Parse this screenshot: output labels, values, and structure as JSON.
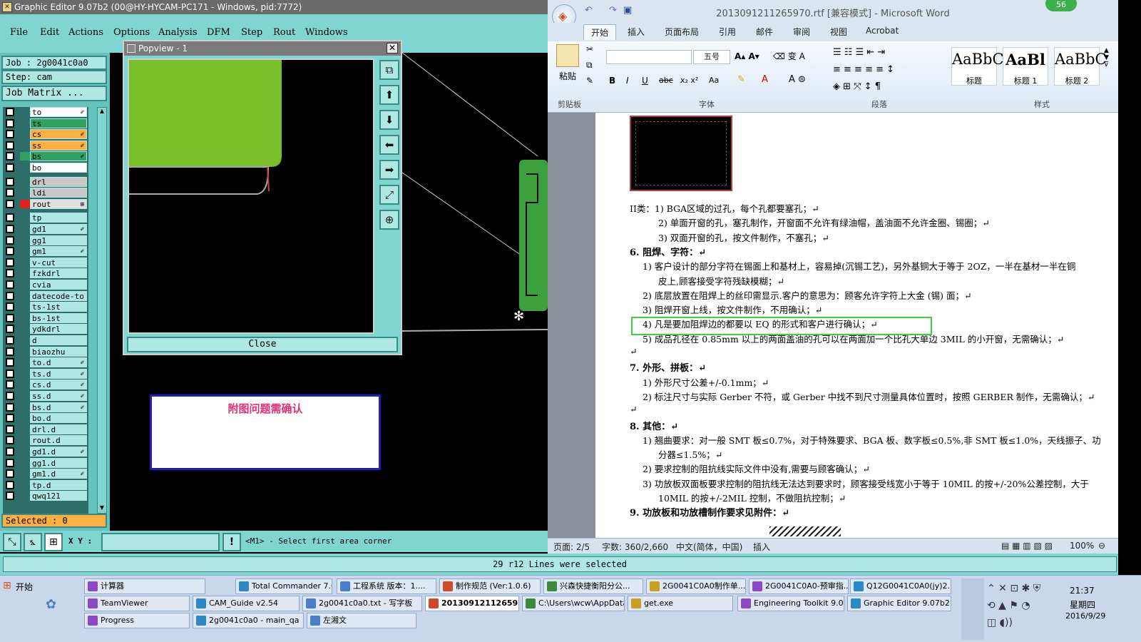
{
  "ge": {
    "title": "Graphic Editor 9.07b2 (00@HY-HYCAM-PC171 - Windows, pid:7772)",
    "menu": [
      "File",
      "Edit",
      "Actions",
      "Options",
      "Analysis",
      "DFM",
      "Step",
      "Rout",
      "Windows"
    ],
    "job": "Job : 2g0041c0a0",
    "step": "Step: cam",
    "job_matrix": "Job Matrix ...",
    "selected": "Selected : 0",
    "xy_label": "X Y :",
    "xy_value": "",
    "prompt": "<M1> - Select first area corner",
    "status": "29 r12 Lines were selected",
    "layers": [
      {
        "name": "to",
        "color": "#ffffff",
        "mark": "✐"
      },
      {
        "name": "ts",
        "color": "#30a060",
        "mark": ""
      },
      {
        "name": "cs",
        "color": "#ffb040",
        "mark": "✐"
      },
      {
        "name": "ss",
        "color": "#ffb040",
        "mark": "✐"
      },
      {
        "name": "bs",
        "color": "#30a060",
        "mark": "✐"
      },
      {
        "name": "bo",
        "color": "#ffffff",
        "mark": ""
      },
      {
        "name": "drl",
        "color": "#c8c8c8",
        "mark": ""
      },
      {
        "name": "ldi",
        "color": "#c8c8c8",
        "mark": ""
      },
      {
        "name": "rout",
        "color": "#e0e0e0",
        "mark": "⊞"
      },
      {
        "name": "tp",
        "color": "#aee7e3",
        "mark": ""
      },
      {
        "name": "gd1",
        "color": "#aee7e3",
        "mark": "✐"
      },
      {
        "name": "gg1",
        "color": "#aee7e3",
        "mark": ""
      },
      {
        "name": "gm1",
        "color": "#aee7e3",
        "mark": "✐"
      },
      {
        "name": "v-cut",
        "color": "#aee7e3",
        "mark": ""
      },
      {
        "name": "fzkdrl",
        "color": "#aee7e3",
        "mark": ""
      },
      {
        "name": "cvia",
        "color": "#aee7e3",
        "mark": ""
      },
      {
        "name": "datecode-to",
        "color": "#aee7e3",
        "mark": ""
      },
      {
        "name": "ts-1st",
        "color": "#aee7e3",
        "mark": ""
      },
      {
        "name": "bs-1st",
        "color": "#aee7e3",
        "mark": ""
      },
      {
        "name": "ydkdrl",
        "color": "#aee7e3",
        "mark": ""
      },
      {
        "name": "d",
        "color": "#aee7e3",
        "mark": ""
      },
      {
        "name": "biaozhu",
        "color": "#aee7e3",
        "mark": ""
      },
      {
        "name": "to.d",
        "color": "#aee7e3",
        "mark": "✐"
      },
      {
        "name": "ts.d",
        "color": "#aee7e3",
        "mark": "✐"
      },
      {
        "name": "cs.d",
        "color": "#aee7e3",
        "mark": "✐"
      },
      {
        "name": "ss.d",
        "color": "#aee7e3",
        "mark": "✐"
      },
      {
        "name": "bs.d",
        "color": "#aee7e3",
        "mark": "✐"
      },
      {
        "name": "bo.d",
        "color": "#aee7e3",
        "mark": ""
      },
      {
        "name": "drl.d",
        "color": "#aee7e3",
        "mark": ""
      },
      {
        "name": "rout.d",
        "color": "#aee7e3",
        "mark": ""
      },
      {
        "name": "gd1.d",
        "color": "#aee7e3",
        "mark": "✐"
      },
      {
        "name": "gg1.d",
        "color": "#aee7e3",
        "mark": ""
      },
      {
        "name": "gm1.d",
        "color": "#aee7e3",
        "mark": "✐"
      },
      {
        "name": "tp.d",
        "color": "#aee7e3",
        "mark": ""
      },
      {
        "name": "qwq121",
        "color": "#aee7e3",
        "mark": ""
      }
    ]
  },
  "popview": {
    "title": "Popview - 1",
    "close_x": "✕",
    "close_button": "Close",
    "tools": [
      "⧉",
      "⬆",
      "⬇",
      "⬅",
      "➡",
      "⤢",
      "⊕"
    ]
  },
  "note": {
    "text": "附图问题需确认"
  },
  "word": {
    "title": "2013091211265970.rtf [兼容模式] - Microsoft Word",
    "badge": "56",
    "tabs": [
      "开始",
      "插入",
      "页面布局",
      "引用",
      "邮件",
      "审阅",
      "视图",
      "Acrobat"
    ],
    "ribbon": {
      "paste": "粘贴",
      "font_name": "",
      "font_size": "五号",
      "groups": [
        "剪贴板",
        "字体",
        "段落",
        "样式"
      ],
      "styles": [
        {
          "sample": "AaBbC",
          "label": "标题"
        },
        {
          "sample": "AaBl",
          "label": "标题 1"
        },
        {
          "sample": "AaBbC",
          "label": "标题 2"
        }
      ]
    },
    "doc": [
      {
        "t": "II类：1) BGA区域的过孔，每个孔都要塞孔；↵",
        "cls": ""
      },
      {
        "t": "2) 单面开窗的孔，塞孔制作，开窗面不允许有绿油帽，盖油面不允许金圈、锡圈；↵",
        "cls": ""
      },
      {
        "t": "3) 双面开窗的孔，按文件制作，不塞孔；↵",
        "cls": ""
      },
      {
        "t": "6.  阻焊、字符：↵",
        "cls": "b"
      },
      {
        "t": "1) 客户设计的部分字符在锡面上和基材上，容易掉(沉锡工艺)，另外基铜大于等于 2OZ，一半在基材一半在铜",
        "cls": ""
      },
      {
        "t": "皮上,顾客接受字符残缺模糊；↵",
        "cls": ""
      },
      {
        "t": "2) 底层放置在阻焊上的丝印需显示.客户的意思为：顾客允许字符上大金 (锡) 面；↵",
        "cls": ""
      },
      {
        "t": "3) 阻焊开窗上线，按文件制作，不用确认；↵",
        "cls": ""
      },
      {
        "t": "4) 凡是要加阻焊边的都要以 EQ 的形式和客户进行确认；↵",
        "cls": ""
      },
      {
        "t": "5) 成品孔径在 0.85mm 以上的两面盖油的孔可以在两面加一个比孔大单边 3MIL 的小开窗，无需确认；↵",
        "cls": ""
      },
      {
        "t": "↵",
        "cls": ""
      },
      {
        "t": "7.  外形、拼板：↵",
        "cls": "b"
      },
      {
        "t": "1) 外形尺寸公差+/-0.1mm；↵",
        "cls": ""
      },
      {
        "t": "2) 标注尺寸与实际 Gerber 不符，或 Gerber 中找不到尺寸测量具体位置时，按照 GERBER 制作，无需确认；↵",
        "cls": ""
      },
      {
        "t": "↵",
        "cls": ""
      },
      {
        "t": "8.  其他：↵",
        "cls": "b"
      },
      {
        "t": "1) 翘曲要求：对一般 SMT 板≤0.7%，对于特殊要求、BGA 板、数字板≤0.5%,非 SMT 板≤1.0%，天线振子、功",
        "cls": ""
      },
      {
        "t": "分器≤1.5%；↵",
        "cls": ""
      },
      {
        "t": "2) 要求控制的阻抗线实际文件中没有,需要与顾客确认；↵",
        "cls": ""
      },
      {
        "t": "3) 功放板双面板要求控制的阻抗线无法达到要求时，顾客接受线宽小于等于 10MIL 的按+/-20%公差控制，大于",
        "cls": ""
      },
      {
        "t": "10MIL 的按+/-2MIL 控制，不做阻抗控制；↵",
        "cls": ""
      },
      {
        "t": "9.  功放板和功放槽制作要求见附件：↵",
        "cls": "b"
      }
    ],
    "status": {
      "page": "页面: 2/5",
      "words": "字数: 360/2,660",
      "lang": "中文(简体，中国)",
      "mode": "插入",
      "zoom": "100%"
    }
  },
  "taskbar": {
    "start": "开始",
    "row1": [
      "计算器",
      "Total Commander 7.0 ...",
      "工程系统  版本：1....",
      "制作规范 (Ver:1.0.6)",
      "兴森快捷衡阳分公...",
      "2G0041C0A0制作单...",
      "2G0041C0A0-预审指...",
      "Q12G0041C0A0(jy)2..."
    ],
    "row2": [
      "TeamViewer",
      "CAM_Guide v2.54",
      "2g0041c0a0.txt - 写字板",
      "2013091211265970...",
      "C:\\Users\\wcw\\AppData...",
      "get.exe",
      "Engineering Toolkit 9.07...",
      "Graphic Editor 9.07b2 (..."
    ],
    "row3": [
      "Progress",
      "2g0041c0a0 - main_qa",
      "左湘文"
    ],
    "time": "21:37",
    "weekday": "星期四",
    "date": "2016/9/29"
  }
}
